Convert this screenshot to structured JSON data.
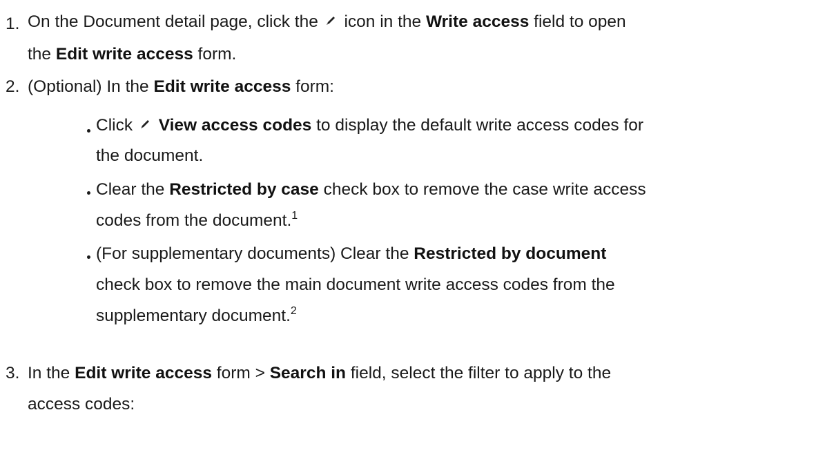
{
  "steps": [
    {
      "number": "1.",
      "line1_a": "On the Document detail page, click the",
      "line1_b": "icon in the",
      "line1_bold1": "Write access",
      "line1_c": "field to open",
      "line2_a": "the",
      "line2_bold": "Edit write access",
      "line2_b": "form."
    },
    {
      "number": "2.",
      "line1_a": "(Optional) In the",
      "line1_bold": "Edit write access",
      "line1_b": "form:",
      "bullets": [
        {
          "b1_a": "Click",
          "b1_bold": "View access codes",
          "b1_b": "to display the default write access codes for",
          "b2": "the document."
        },
        {
          "b1_a": "Clear the",
          "b1_bold": "Restricted by case",
          "b1_b": "check box to remove the case write access",
          "b2": "codes from the document.",
          "sup": "1"
        },
        {
          "b1_a": "(For supplementary documents) Clear the",
          "b1_bold": "Restricted by document",
          "b2": "check box to remove the main document write access codes from the",
          "b3": "supplementary document.",
          "sup": "2"
        }
      ]
    },
    {
      "number": "3.",
      "line1_a": "In the",
      "line1_bold1": "Edit write access",
      "line1_b": "form >",
      "line1_bold2": "Search in",
      "line1_c": "field, select the filter to apply to the",
      "line2": "access codes:"
    }
  ],
  "icons": {
    "pencil": "pencil-icon"
  }
}
